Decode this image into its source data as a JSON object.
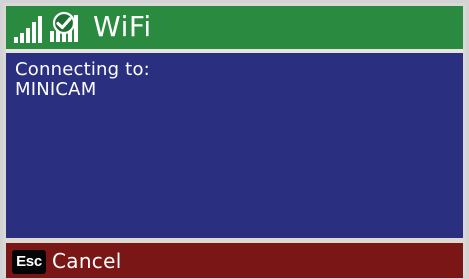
{
  "header": {
    "title": "WiFi",
    "icons": {
      "signal": "signal-strength-icon",
      "status": "wifi-status-check-icon"
    }
  },
  "content": {
    "lines": [
      "Connecting to:",
      "MINICAM"
    ]
  },
  "footer": {
    "key_label": "Esc",
    "action_label": "Cancel"
  },
  "colors": {
    "header": "#2a8a3f",
    "content": "#2b2f7f",
    "footer": "#7a1716",
    "text": "#ffffff"
  }
}
